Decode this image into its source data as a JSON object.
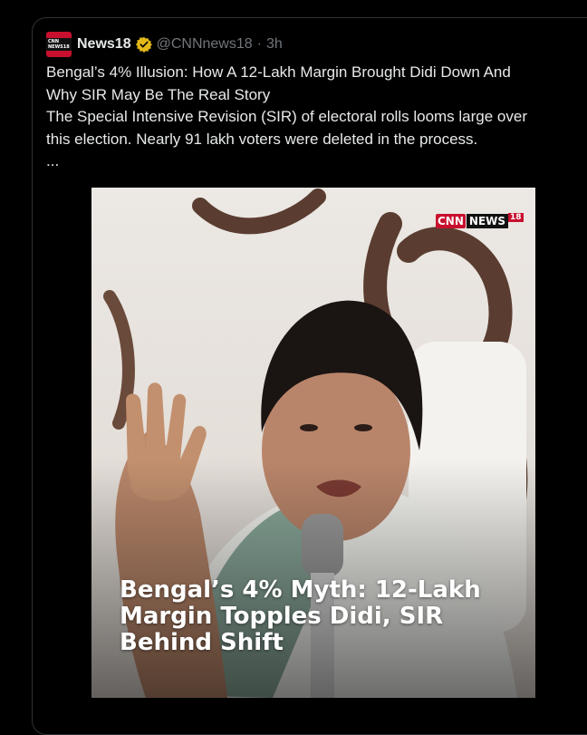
{
  "tweet": {
    "author_name": "News18",
    "handle": "@CNNnews18",
    "separator": "·",
    "time": "3h",
    "lines": [
      "Bengal’s 4% Illusion: How A 12-Lakh Margin Brought Didi Down And",
      "Why SIR May Be The Real Story",
      "The Special Intensive Revision (SIR) of electoral rolls looms large over",
      "this election. Nearly 91 lakh voters were deleted in the process.",
      "..."
    ]
  },
  "avatar": {
    "logo_text": "CNN NEWS18"
  },
  "verified_badge": {
    "icon": "verified-badge-icon",
    "color": "#e2b719"
  },
  "media": {
    "watermark": {
      "part1": "CNN",
      "part2": "NEWS",
      "part3": "18"
    },
    "headline_lines": [
      "Bengal’s 4% Myth: 12-Lakh",
      "Margin Topples Didi, SIR",
      "Behind Shift"
    ]
  },
  "colors": {
    "accent": "#c8102e",
    "muted": "#71767b",
    "text": "#e7e9ea"
  }
}
